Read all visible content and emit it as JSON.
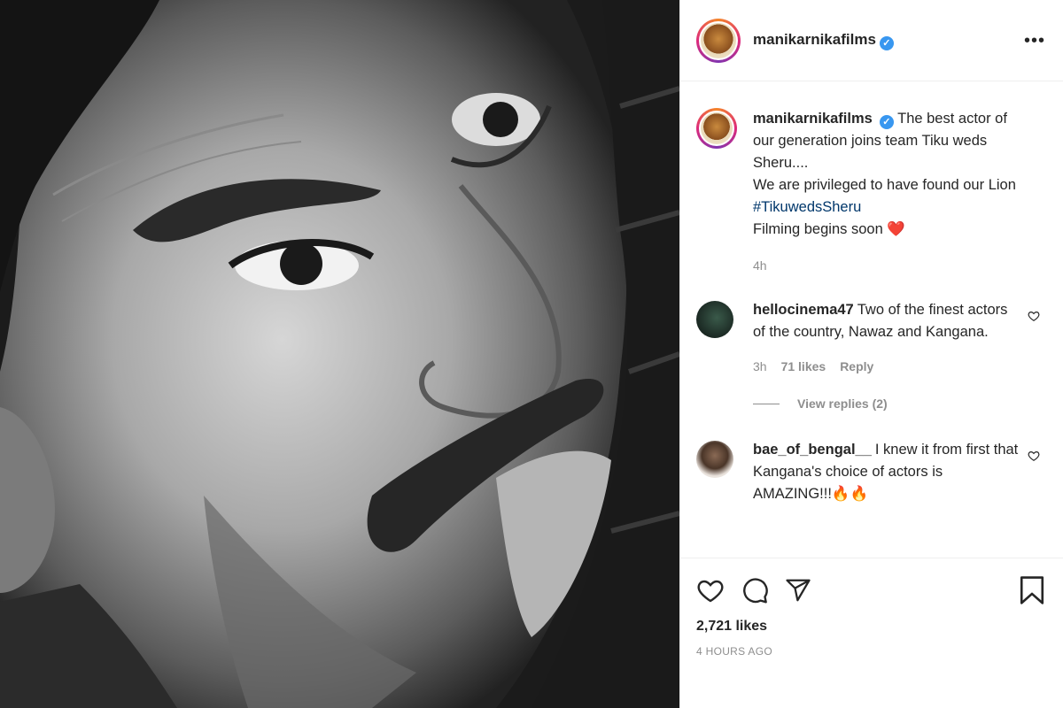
{
  "post": {
    "username": "manikarnikafilms",
    "verified_mark": "✓",
    "more_icon": "•••"
  },
  "caption": {
    "username": "manikarnikafilms",
    "line1": "The best actor of our generation joins team Tiku weds Sheru....",
    "line2": "We are privileged to have found our Lion ",
    "hashtag": "#TikuwedsSheru",
    "line3": "Filming begins soon ",
    "emoji": "❤️",
    "time": "4h"
  },
  "comments": [
    {
      "username": "hellocinema47",
      "text": "Two of the finest actors of the country, Nawaz and Kangana.",
      "time": "3h",
      "likes": "71 likes",
      "reply": "Reply",
      "view_replies": "View replies (2)"
    },
    {
      "username": "bae_of_bengal__",
      "text": "I knew it from first that Kangana's choice of actors is AMAZING!!!🔥🔥"
    }
  ],
  "actions": {
    "icons": [
      "heart-icon",
      "comment-icon",
      "share-icon",
      "bookmark-icon"
    ],
    "likes": "2,721 likes",
    "timestamp": "4 HOURS AGO"
  },
  "colors": {
    "accent_blue": "#3897f0",
    "hashtag": "#00376b",
    "muted": "#8e8e8e",
    "text": "#262626"
  }
}
